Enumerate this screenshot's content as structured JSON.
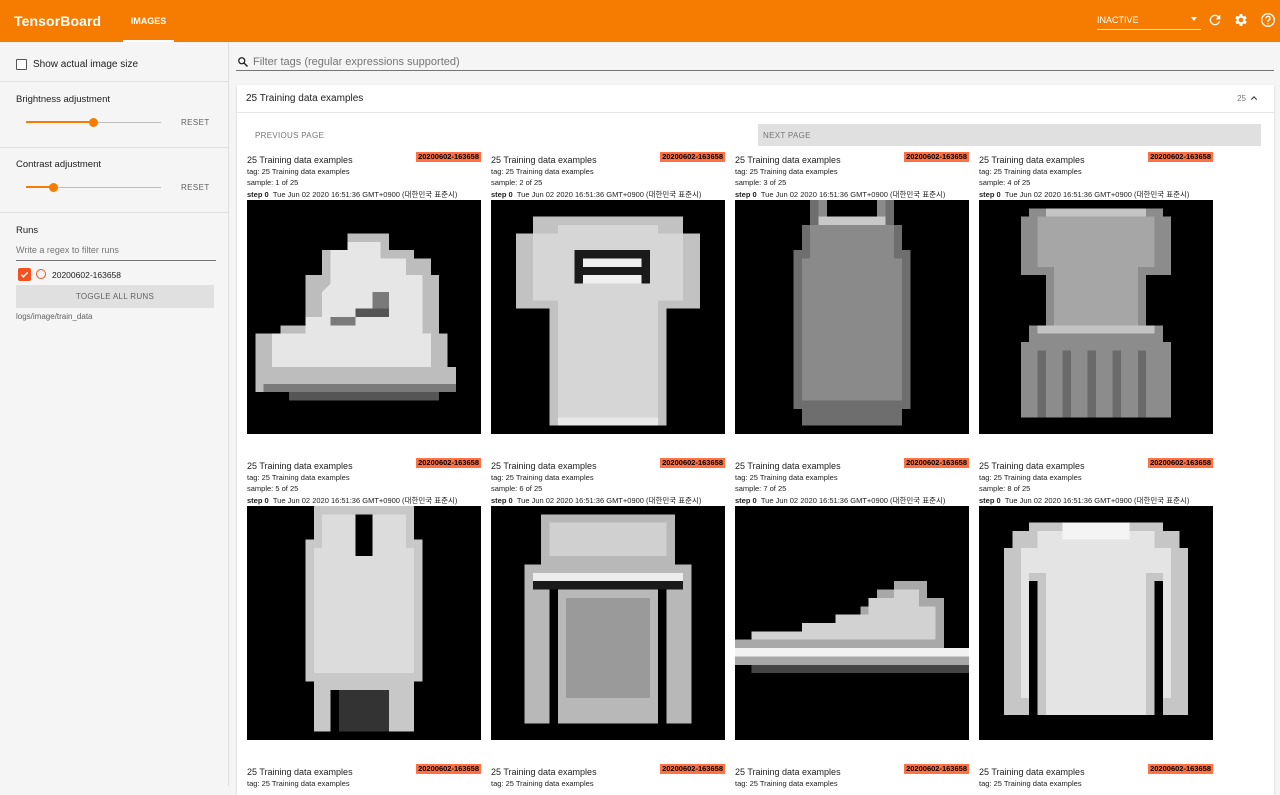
{
  "app": {
    "title": "TensorBoard",
    "active_tab": "IMAGES",
    "run_status": "INACTIVE",
    "accent": "#f57c00"
  },
  "sidebar": {
    "show_actual_size_label": "Show actual image size",
    "brightness": {
      "label": "Brightness adjustment",
      "reset": "RESET",
      "value": 0.5
    },
    "contrast": {
      "label": "Contrast adjustment",
      "reset": "RESET",
      "value": 0.2
    },
    "runs": {
      "title": "Runs",
      "filter_placeholder": "Write a regex to filter runs",
      "items": [
        {
          "name": "20200602-163658",
          "checked": true
        }
      ],
      "toggle_all": "TOGGLE ALL RUNS",
      "logdir": "logs/image/train_data"
    }
  },
  "filter": {
    "placeholder": "Filter tags (regular expressions supported)"
  },
  "card": {
    "title": "25 Training data examples",
    "count": "25",
    "prev": "PREVIOUS PAGE",
    "next": "NEXT PAGE",
    "images": [
      {
        "title": "25 Training data examples",
        "run": "20200602-163658",
        "tag": "tag: 25 Training data examples",
        "sample": "sample: 1 of 25",
        "step": "step 0",
        "time": "Tue Jun 02 2020 16:51:36 GMT+0900 (대한민국 표준시)",
        "icon": "ankle-boot-icon"
      },
      {
        "title": "25 Training data examples",
        "run": "20200602-163658",
        "tag": "tag: 25 Training data examples",
        "sample": "sample: 2 of 25",
        "step": "step 0",
        "time": "Tue Jun 02 2020 16:51:36 GMT+0900 (대한민국 표준시)",
        "icon": "tshirt-icon"
      },
      {
        "title": "25 Training data examples",
        "run": "20200602-163658",
        "tag": "tag: 25 Training data examples",
        "sample": "sample: 3 of 25",
        "step": "step 0",
        "time": "Tue Jun 02 2020 16:51:36 GMT+0900 (대한민국 표준시)",
        "icon": "tank-top-icon"
      },
      {
        "title": "25 Training data examples",
        "run": "20200602-163658",
        "tag": "tag: 25 Training data examples",
        "sample": "sample: 4 of 25",
        "step": "step 0",
        "time": "Tue Jun 02 2020 16:51:36 GMT+0900 (대한민국 표준시)",
        "icon": "dress-icon"
      },
      {
        "title": "25 Training data examples",
        "run": "20200602-163658",
        "tag": "tag: 25 Training data examples",
        "sample": "sample: 5 of 25",
        "step": "step 0",
        "time": "Tue Jun 02 2020 16:51:36 GMT+0900 (대한민국 표준시)",
        "icon": "overall-icon"
      },
      {
        "title": "25 Training data examples",
        "run": "20200602-163658",
        "tag": "tag: 25 Training data examples",
        "sample": "sample: 6 of 25",
        "step": "step 0",
        "time": "Tue Jun 02 2020 16:51:36 GMT+0900 (대한민국 표준시)",
        "icon": "pullover-icon"
      },
      {
        "title": "25 Training data examples",
        "run": "20200602-163658",
        "tag": "tag: 25 Training data examples",
        "sample": "sample: 7 of 25",
        "step": "step 0",
        "time": "Tue Jun 02 2020 16:51:36 GMT+0900 (대한민국 표준시)",
        "icon": "sneaker-icon"
      },
      {
        "title": "25 Training data examples",
        "run": "20200602-163658",
        "tag": "tag: 25 Training data examples",
        "sample": "sample: 8 of 25",
        "step": "step 0",
        "time": "Tue Jun 02 2020 16:51:36 GMT+0900 (대한민국 표준시)",
        "icon": "sweater-icon"
      },
      {
        "title": "25 Training data examples",
        "run": "20200602-163658",
        "tag": "tag: 25 Training data examples"
      },
      {
        "title": "25 Training data examples",
        "run": "20200602-163658",
        "tag": "tag: 25 Training data examples"
      },
      {
        "title": "25 Training data examples",
        "run": "20200602-163658",
        "tag": "tag: 25 Training data examples"
      },
      {
        "title": "25 Training data examples",
        "run": "20200602-163658",
        "tag": "tag: 25 Training data examples"
      }
    ]
  }
}
